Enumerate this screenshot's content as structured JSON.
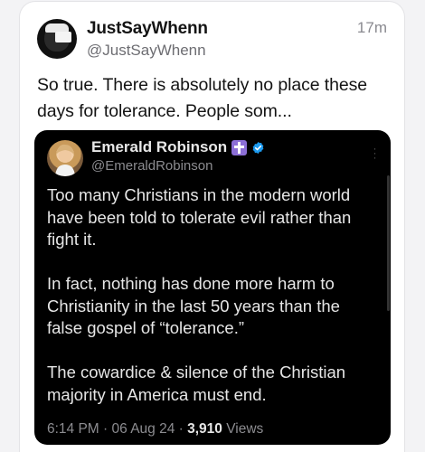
{
  "post": {
    "author_name": "JustSayWhenn",
    "author_handle": "@JustSayWhenn",
    "time": "17m",
    "text": "So true. There is absolutely no place these days for tolerance. People som..."
  },
  "embedded": {
    "author_name": "Emerald Robinson",
    "author_handle": "@EmeraldRobinson",
    "paragraphs": [
      "Too many Christians in the modern world have been told to tolerate evil rather than fight it.",
      "In fact, nothing has done more harm to Christianity in the last 50 years than the false gospel of “tolerance.”",
      "The cowardice & silence of the Christian majority in America must end."
    ],
    "meta_time": "6:14 PM · 06 Aug 24 · ",
    "views_count": "3,910",
    "views_label": " Views"
  },
  "icons": {
    "author_avatar": "profile-photo-icon",
    "embed_avatar": "profile-photo-icon",
    "badge": "cross-badge-icon",
    "verified": "verified-check-icon",
    "more": "more-vertical-icon"
  },
  "colors": {
    "verified_blue": "#1d9bf0",
    "cross_badge": "#8c6fd6",
    "embed_background": "#000000"
  }
}
